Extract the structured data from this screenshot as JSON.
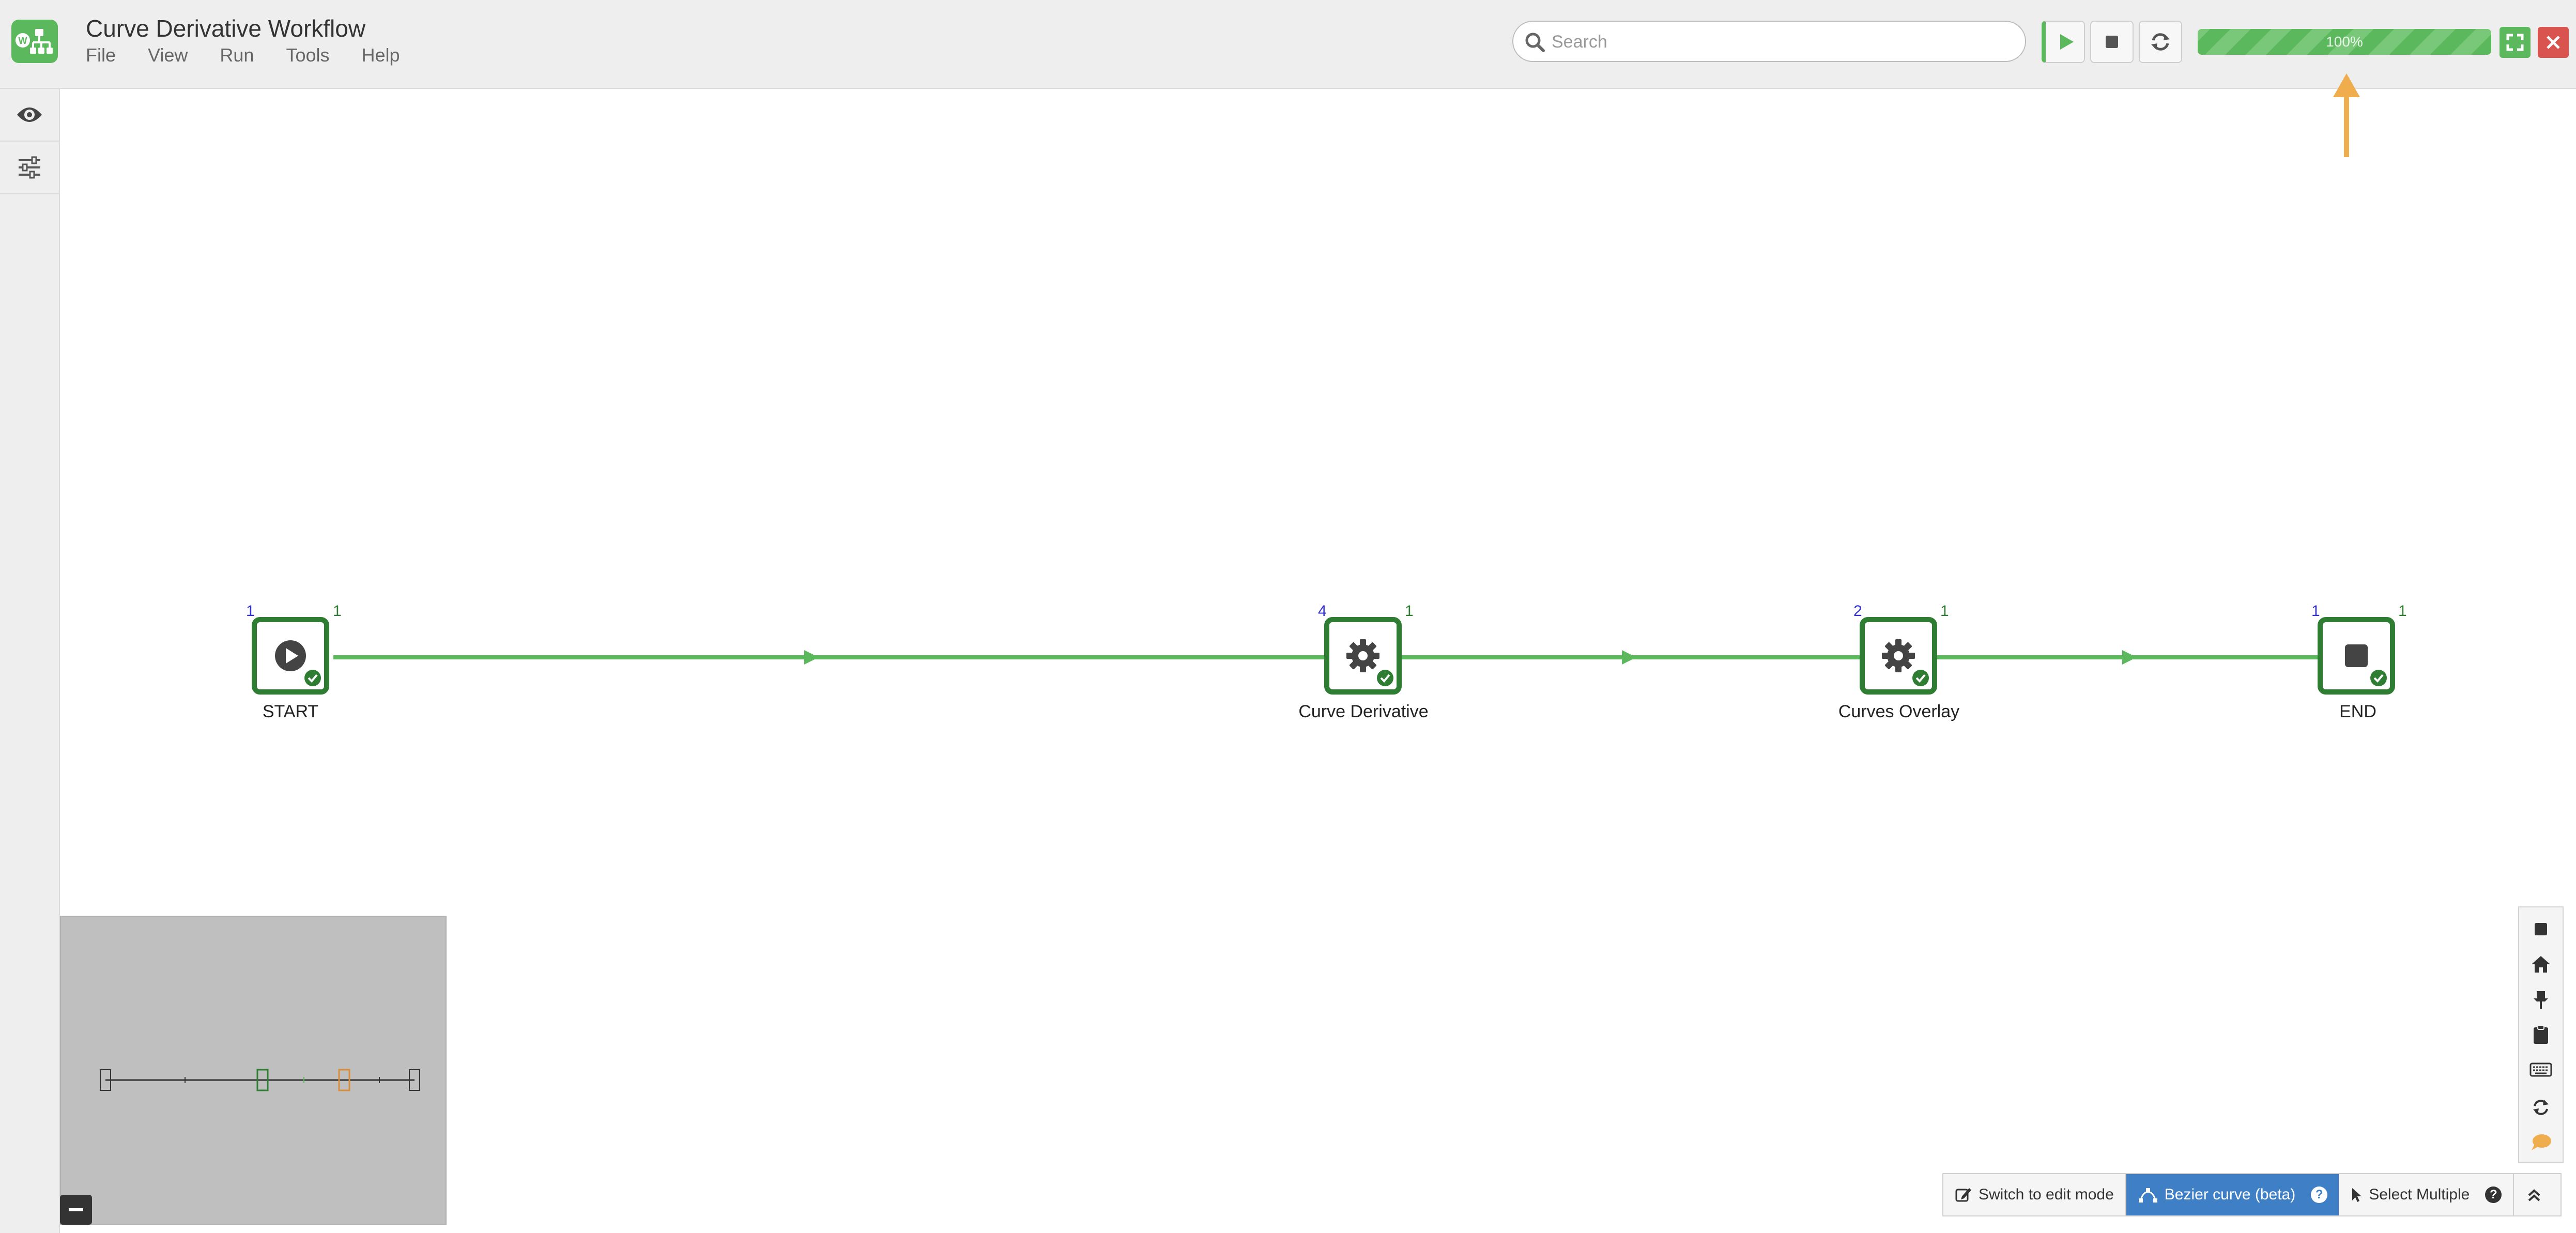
{
  "header": {
    "app_title": "Curve Derivative Workflow",
    "menu": [
      {
        "label": "File"
      },
      {
        "label": "View"
      },
      {
        "label": "Run"
      },
      {
        "label": "Tools"
      },
      {
        "label": "Help"
      }
    ],
    "search": {
      "placeholder": "Search",
      "value": ""
    },
    "toolbar_icons": [
      "play-icon",
      "stop-icon",
      "refresh-icon"
    ],
    "progress": {
      "value": 1.0,
      "label": "100%"
    },
    "window_icons": [
      "maximize-icon",
      "close-icon"
    ],
    "colors": {
      "accent_green": "#5cb85c",
      "close_red": "#d9534f",
      "annotation_arrow": "#f0ad4e"
    }
  },
  "sidebar": {
    "icons": [
      "eye-icon",
      "sliders-icon"
    ]
  },
  "workflow": {
    "nodes": [
      {
        "label": "START",
        "ports_in": "1",
        "ports_out": "1",
        "icon": "play-circle-icon",
        "status": "success"
      },
      {
        "label": "Curve Derivative",
        "ports_in": "4",
        "ports_out": "1",
        "icon": "gear-icon",
        "status": "success"
      },
      {
        "label": "Curves Overlay",
        "ports_in": "2",
        "ports_out": "1",
        "icon": "gear-icon",
        "status": "success"
      },
      {
        "label": "END",
        "ports_in": "1",
        "ports_out": "1",
        "icon": "stop-square-icon",
        "status": "success"
      }
    ],
    "colors": {
      "node_border": "#2e7d32",
      "edge": "#5cb85c",
      "port_in": "#3333cc",
      "port_out": "#2e7d32"
    }
  },
  "minimap": {
    "collapse_label": "−"
  },
  "right_toolbar": {
    "icons": [
      "square-icon",
      "home-icon",
      "pin-icon",
      "clipboard-icon",
      "keyboard-icon",
      "refresh-icon",
      "comment-icon"
    ]
  },
  "bottom_toolbar": {
    "edit_mode_label": "Switch to edit mode",
    "bezier_label": "Bezier curve (beta)",
    "select_multiple_label": "Select Multiple",
    "help_glyph": "?",
    "expand_icon": "double-chevron-up-icon",
    "colors": {
      "active_bg": "#3f7fc6"
    }
  }
}
